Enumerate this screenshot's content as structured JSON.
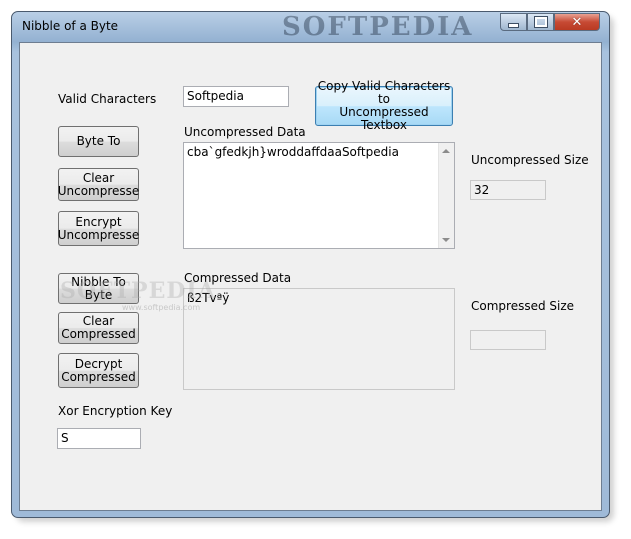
{
  "window": {
    "title": "Nibble of a Byte",
    "watermark": "SOFTPEDIA",
    "min_icon": "minimize-icon",
    "max_icon": "maximize-icon",
    "close_icon": "close-icon"
  },
  "labels": {
    "valid_characters": "Valid Characters",
    "uncompressed_data": "Uncompressed Data",
    "uncompressed_size": "Uncompressed Size",
    "compressed_data": "Compressed Data",
    "compressed_size": "Compressed Size",
    "xor_key": "Xor Encryption Key"
  },
  "buttons": {
    "copy_valid": "Copy Valid Characters to\nUncompressed Textbox",
    "byte_to": "Byte To",
    "clear_uncompress": "Clear\nUncompresse",
    "encrypt_uncompress": "Encrypt\nUncompresse",
    "nibble_to_byte": "Nibble To\nByte",
    "clear_compressed": "Clear\nCompressed",
    "decrypt_compressed": "Decrypt\nCompressed"
  },
  "fields": {
    "valid_characters_value": "Softpedia",
    "uncompressed_text": "cba`gfedkjh}wroddaffdaaSoftpedia",
    "uncompressed_size_value": "32",
    "compressed_text": "ß2Tvªÿ",
    "compressed_size_value": "",
    "xor_key_value": "S"
  },
  "overlay": {
    "watermark": "SOFTPEDIA",
    "watermark_sub": "www.softpedia.com"
  }
}
